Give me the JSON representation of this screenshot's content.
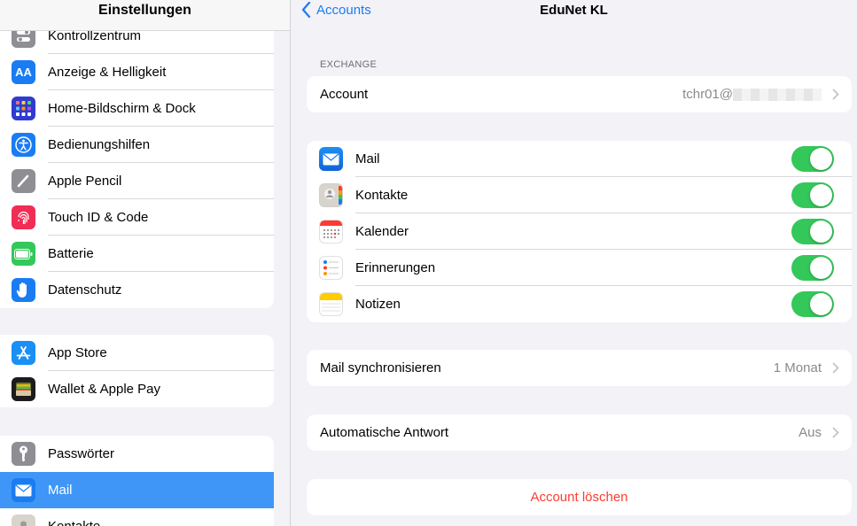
{
  "sidebar": {
    "title": "Einstellungen",
    "groups": [
      [
        {
          "label": "Kontrollzentrum",
          "icon": "control-center-icon",
          "color": "#8e8e93"
        },
        {
          "label": "Anzeige & Helligkeit",
          "icon": "display-icon",
          "color": "#1a7cf2"
        },
        {
          "label": "Home-Bildschirm & Dock",
          "icon": "home-screen-icon",
          "color": "#2f3bd0"
        },
        {
          "label": "Bedienungshilfen",
          "icon": "accessibility-icon",
          "color": "#1a7cf2"
        },
        {
          "label": "Apple Pencil",
          "icon": "pencil-icon",
          "color": "#8e8e93"
        },
        {
          "label": "Touch ID & Code",
          "icon": "fingerprint-icon",
          "color": "#f02d55"
        },
        {
          "label": "Batterie",
          "icon": "battery-icon",
          "color": "#34c759"
        },
        {
          "label": "Datenschutz",
          "icon": "hand-icon",
          "color": "#1a7cf2"
        }
      ],
      [
        {
          "label": "App Store",
          "icon": "app-store-icon",
          "color": "#1a8ff5"
        },
        {
          "label": "Wallet & Apple Pay",
          "icon": "wallet-icon",
          "color": "#1c1c1e"
        }
      ],
      [
        {
          "label": "Passwörter",
          "icon": "key-icon",
          "color": "#8e8e93"
        },
        {
          "label": "Mail",
          "icon": "mail-icon",
          "color": "#1a7cf2",
          "selected": true
        },
        {
          "label": "Kontakte",
          "icon": "contacts-icon",
          "color": "#b0b0b5"
        }
      ]
    ]
  },
  "nav": {
    "back_label": "Accounts",
    "title": "EduNet KL"
  },
  "exchange": {
    "section_label": "EXCHANGE",
    "account_label": "Account",
    "account_value": "tchr01@"
  },
  "apps": [
    {
      "label": "Mail",
      "icon": "mail-app-icon",
      "on": true
    },
    {
      "label": "Kontakte",
      "icon": "contacts-app-icon",
      "on": true
    },
    {
      "label": "Kalender",
      "icon": "calendar-app-icon",
      "on": true
    },
    {
      "label": "Erinnerungen",
      "icon": "reminders-app-icon",
      "on": true
    },
    {
      "label": "Notizen",
      "icon": "notes-app-icon",
      "on": true
    }
  ],
  "sync": {
    "label": "Mail synchronisieren",
    "value": "1 Monat"
  },
  "auto_reply": {
    "label": "Automatische Antwort",
    "value": "Aus"
  },
  "delete_label": "Account löschen",
  "colors": {
    "accent": "#1a7cf2",
    "toggle_on": "#34c759",
    "destructive": "#ff3b30",
    "selected": "#3f96f7"
  }
}
